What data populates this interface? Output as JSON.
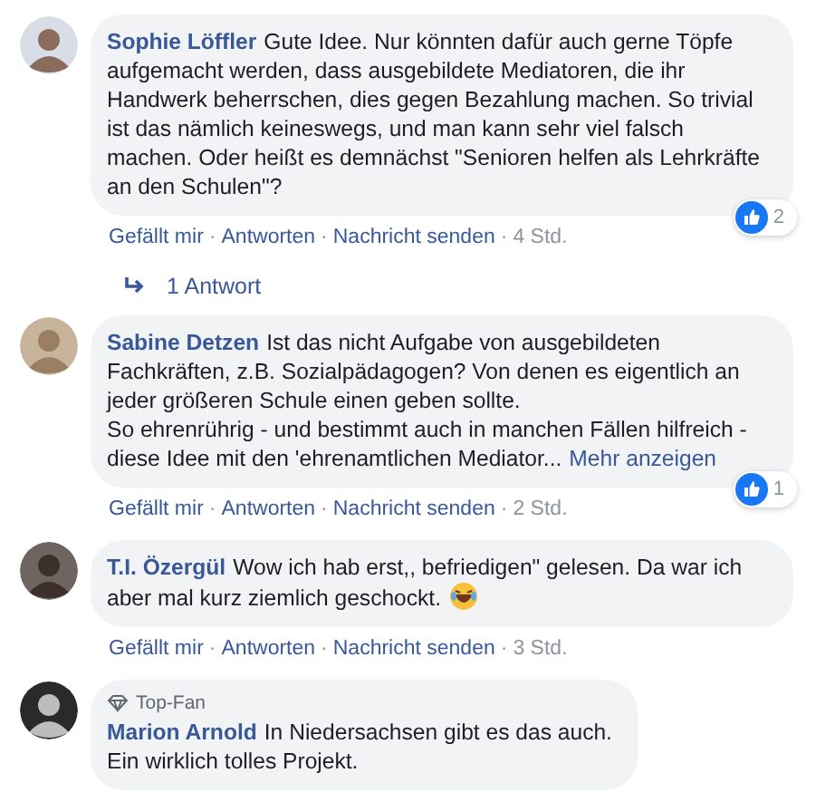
{
  "comments": [
    {
      "author": "Sophie Löffler",
      "paragraphs": [
        "Gute Idee. Nur könnten dafür auch gerne Töpfe aufgemacht werden, dass ausgebildete Mediatoren, die ihr Handwerk beherrschen, dies gegen Bezahlung machen. So trivial ist das nämlich keineswegs, und man kann sehr viel falsch machen. Oder heißt es demnächst \"Senioren helfen als Lehrkräfte an den Schulen\"?"
      ],
      "has_emoji": false,
      "reactions": "2",
      "actions": [
        "Gefällt mir",
        "·",
        "Antworten",
        "·",
        "Nachricht senden",
        "·"
      ],
      "time": "4 Std.",
      "replies_link": "1 Antwort"
    },
    {
      "author": "Sabine Detzen",
      "paragraphs": [
        "Ist das nicht Aufgabe von ausgebildeten Fachkräften, z.B. Sozialpädagogen? Von denen es eigentlich an jeder größeren Schule einen geben sollte.",
        "So ehrenrührig - und bestimmt auch in manchen Fällen hilfreich - diese Idee mit den 'ehrenamtlichen Mediator..."
      ],
      "more_link": "Mehr anzeigen",
      "has_emoji": false,
      "reactions": "1",
      "actions": [
        "Gefällt mir",
        "·",
        "Antworten",
        "·",
        "Nachricht senden",
        "·"
      ],
      "time": "2 Std."
    },
    {
      "author": "T.I. Özergül",
      "paragraphs": [
        "Wow ich hab erst,, befriedigen\" gelesen. Da war ich aber mal kurz ziemlich geschockt."
      ],
      "has_emoji": true,
      "actions": [
        "Gefällt mir",
        "·",
        "Antworten",
        "·",
        "Nachricht senden",
        "·"
      ],
      "time": "3 Std."
    },
    {
      "author": "Marion Arnold",
      "badge": "Top-Fan",
      "paragraphs": [
        "In Niedersachsen gibt es das auch.",
        "Ein wirklich tolles Projekt."
      ],
      "has_emoji": false
    }
  ]
}
